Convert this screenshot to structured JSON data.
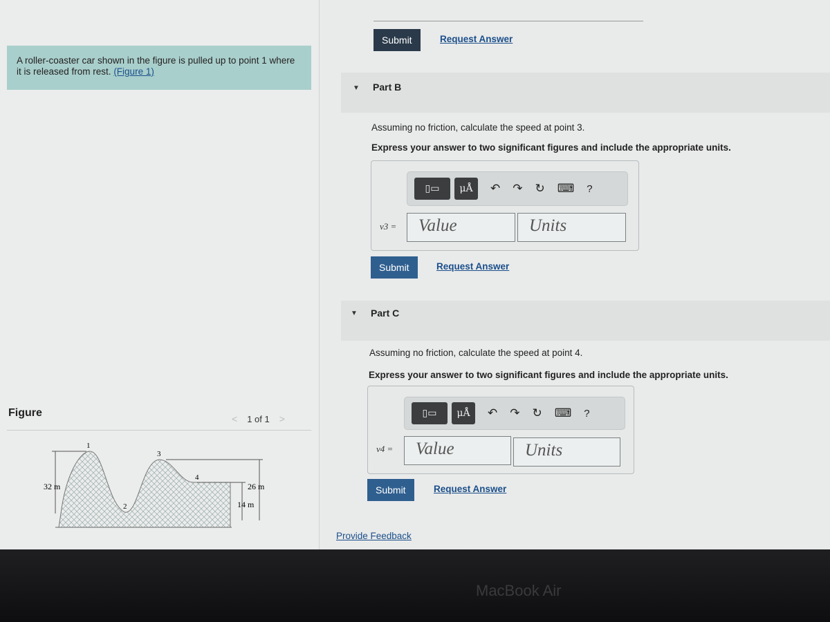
{
  "problem": {
    "intro_text": "A roller-coaster car shown in the figure is pulled up to point 1 where it is released from rest.",
    "figure_link": "(Figure 1)"
  },
  "figure": {
    "title": "Figure",
    "pager": "1 of 1",
    "prev": "<",
    "next": ">",
    "labels": {
      "p1": "1",
      "p2": "2",
      "p3": "3",
      "p4": "4",
      "h1": "32 m",
      "h3": "26 m",
      "h4": "14 m"
    }
  },
  "top": {
    "submit": "Submit",
    "request": "Request Answer"
  },
  "partB": {
    "label": "Part B",
    "question": "Assuming no friction, calculate the speed at point 3.",
    "instruction": "Express your answer to two significant figures and include the appropriate units.",
    "var": "v3 =",
    "value_placeholder": "Value",
    "units_placeholder": "Units",
    "submit": "Submit",
    "request": "Request Answer"
  },
  "partC": {
    "label": "Part C",
    "question": "Assuming no friction, calculate the speed at point 4.",
    "instruction": "Express your answer to two significant figures and include the appropriate units.",
    "var": "v4 =",
    "value_placeholder": "Value",
    "units_placeholder": "Units",
    "submit": "Submit",
    "request": "Request Answer"
  },
  "toolbar": {
    "templates": "template-icon",
    "units": "μÅ",
    "undo": "↶",
    "redo": "↷",
    "reset": "↻",
    "keyboard": "⌨",
    "help": "?"
  },
  "feedback": "Provide Feedback",
  "device": "MacBook Air"
}
